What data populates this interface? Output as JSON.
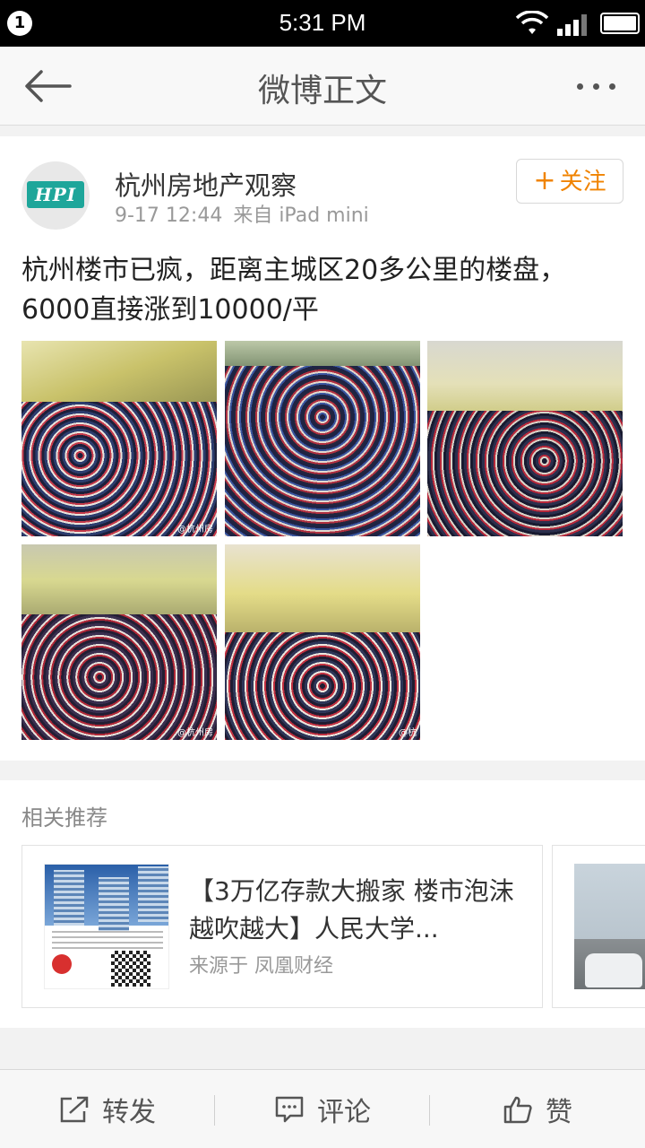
{
  "status_bar": {
    "notification_count": "1",
    "time": "5:31 PM",
    "wifi_icon": "wifi-icon",
    "signal_icon": "signal-icon",
    "battery_icon": "battery-icon"
  },
  "nav": {
    "title": "微博正文",
    "back_icon": "back-arrow-icon",
    "more_icon": "more-dots-icon"
  },
  "post": {
    "author": "杭州房地产观察",
    "avatar_text": "HPI",
    "time": "9-17 12:44",
    "source": "来自 iPad mini",
    "follow_label": "关注",
    "text": "杭州楼市已疯，距离主城区20多公里的楼盘，6000直接涨到10000/平",
    "photos": [
      {
        "watermark": "@杭州房"
      },
      {
        "watermark": ""
      },
      {
        "watermark": ""
      },
      {
        "watermark": "@杭州房"
      },
      {
        "watermark": "@杭"
      }
    ]
  },
  "recommend": {
    "section_title": "相关推荐",
    "cards": [
      {
        "headline": "【3万亿存款大搬家 楼市泡沫越吹越大】人民大学...",
        "source": "来源于 凤凰财经"
      }
    ]
  },
  "toolbar": {
    "repost_label": "转发",
    "comment_label": "评论",
    "like_label": "赞"
  },
  "colors": {
    "accent_orange": "#f08300",
    "avatar_teal": "#1ea69a",
    "status_bar_bg": "#000000"
  }
}
